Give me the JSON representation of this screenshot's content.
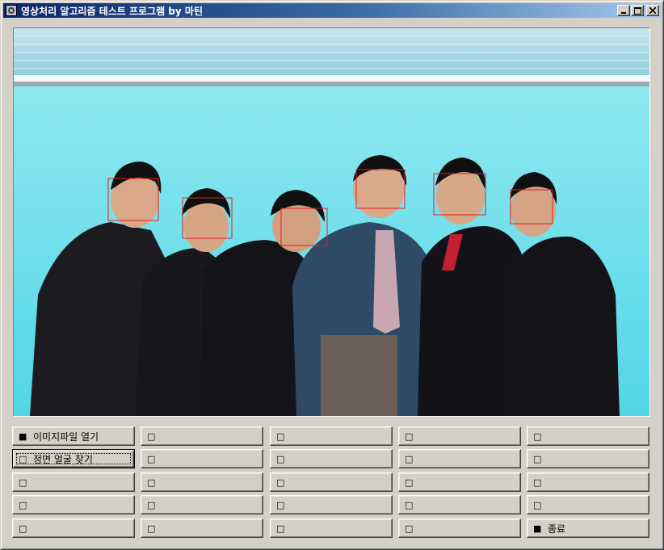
{
  "window": {
    "title": "영상처리 알고리즘 테스트 프로그램 by 마틴",
    "controls": [
      "minimize",
      "maximize",
      "close"
    ]
  },
  "image": {
    "description_icon": "photo-canvas",
    "detected_faces": 6
  },
  "buttons": {
    "col1": [
      {
        "glyph": "■",
        "label": "이미지파일 열기"
      },
      {
        "glyph": "□",
        "label": "정면 얼굴 찾기"
      },
      {
        "glyph": "□",
        "label": ""
      },
      {
        "glyph": "□",
        "label": ""
      },
      {
        "glyph": "□",
        "label": ""
      }
    ],
    "col2": [
      {
        "glyph": "□",
        "label": ""
      },
      {
        "glyph": "□",
        "label": ""
      },
      {
        "glyph": "□",
        "label": ""
      },
      {
        "glyph": "□",
        "label": ""
      },
      {
        "glyph": "□",
        "label": ""
      }
    ],
    "col3": [
      {
        "glyph": "□",
        "label": ""
      },
      {
        "glyph": "□",
        "label": ""
      },
      {
        "glyph": "□",
        "label": ""
      },
      {
        "glyph": "□",
        "label": ""
      },
      {
        "glyph": "□",
        "label": ""
      }
    ],
    "col4": [
      {
        "glyph": "□",
        "label": ""
      },
      {
        "glyph": "□",
        "label": ""
      },
      {
        "glyph": "□",
        "label": ""
      },
      {
        "glyph": "□",
        "label": ""
      },
      {
        "glyph": "□",
        "label": ""
      }
    ],
    "col5": [
      {
        "glyph": "□",
        "label": ""
      },
      {
        "glyph": "□",
        "label": ""
      },
      {
        "glyph": "□",
        "label": ""
      },
      {
        "glyph": "□",
        "label": ""
      },
      {
        "glyph": "■",
        "label": "종료"
      }
    ]
  },
  "colors": {
    "titlebar_start": "#0a246a",
    "titlebar_end": "#a6caf0",
    "face_box": "#e02020",
    "face_color": "#e02020",
    "window_face": "#d4d0c8"
  }
}
